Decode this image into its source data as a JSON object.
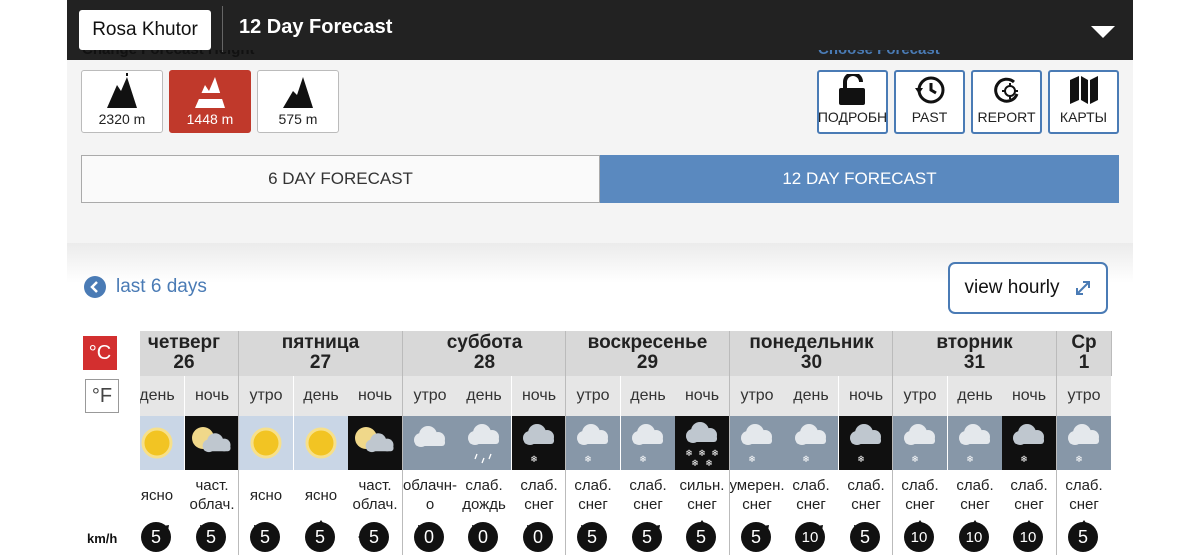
{
  "header": {
    "location": "Rosa Khutor",
    "title": "12 Day Forecast"
  },
  "height_section": {
    "label": "Change Forecast Height",
    "buttons": [
      {
        "label": "2320 m",
        "icon": "mountain-top-icon",
        "active": false
      },
      {
        "label": "1448 m",
        "icon": "mountain-mid-icon",
        "active": true
      },
      {
        "label": "575 m",
        "icon": "mountain-bottom-icon",
        "active": false
      }
    ]
  },
  "choose_section": {
    "label": "Choose Forecast",
    "buttons": [
      {
        "label": "ПОДРОБН",
        "icon": "unlock-icon"
      },
      {
        "label": "PAST",
        "icon": "history-icon"
      },
      {
        "label": "REPORT",
        "icon": "report-icon"
      },
      {
        "label": "КАРТЫ",
        "icon": "map-icon"
      }
    ]
  },
  "tabs": {
    "six_day": "6 DAY FORECAST",
    "twelve_day": "12 DAY FORECAST",
    "active": "12 DAY FORECAST"
  },
  "nav": {
    "last_days": "last 6 days",
    "view_hourly": "view hourly"
  },
  "units": {
    "celsius": "°C",
    "fahrenheit": "°F",
    "active": "°C",
    "wind_unit": "km/h"
  },
  "colors": {
    "accent_blue": "#4a7bb5",
    "tab_active": "#5a89bf",
    "height_active": "#c0392b",
    "unit_active": "#d32f2f",
    "topbar": "#222222"
  },
  "forecast": {
    "days": [
      {
        "name": "четверг",
        "date": "26"
      },
      {
        "name": "пятница",
        "date": "27"
      },
      {
        "name": "суббота",
        "date": "28"
      },
      {
        "name": "воскресенье",
        "date": "29"
      },
      {
        "name": "понедельник",
        "date": "30"
      },
      {
        "name": "вторник",
        "date": "31"
      },
      {
        "name": "Ср",
        "date": "1"
      }
    ],
    "periods": [
      {
        "period": "день",
        "icon": "sun-icon",
        "desc": "ясно",
        "wind": "5",
        "dir": 45
      },
      {
        "period": "ночь",
        "icon": "night-partly-cloudy-icon",
        "desc": "част. облач.",
        "wind": "5",
        "dir": -45
      },
      {
        "period": "утро",
        "icon": "sun-icon",
        "desc": "ясно",
        "wind": "5",
        "dir": -45
      },
      {
        "period": "день",
        "icon": "sun-icon",
        "desc": "ясно",
        "wind": "5",
        "dir": 0
      },
      {
        "period": "ночь",
        "icon": "night-partly-cloudy-icon",
        "desc": "част. облач.",
        "wind": "5",
        "dir": -90
      },
      {
        "period": "утро",
        "icon": "cloud-icon",
        "desc": "облачн- о",
        "wind": "0",
        "dir": -45
      },
      {
        "period": "день",
        "icon": "rain-icon",
        "desc": "слаб. дождь",
        "wind": "0",
        "dir": -45
      },
      {
        "period": "ночь",
        "icon": "night-snow-icon",
        "desc": "слаб. снег",
        "wind": "0",
        "dir": -45
      },
      {
        "period": "утро",
        "icon": "snow-icon",
        "desc": "слаб. снег",
        "wind": "5",
        "dir": -45
      },
      {
        "period": "день",
        "icon": "snow-icon",
        "desc": "слаб. снег",
        "wind": "5",
        "dir": 45
      },
      {
        "period": "ночь",
        "icon": "night-heavy-snow-icon",
        "desc": "сильн. снег",
        "wind": "5",
        "dir": 0
      },
      {
        "period": "утро",
        "icon": "snow-icon",
        "desc": "умерен. снег",
        "wind": "5",
        "dir": 45
      },
      {
        "period": "день",
        "icon": "snow-icon",
        "desc": "слаб. снег",
        "wind": "10",
        "dir": 45
      },
      {
        "period": "ночь",
        "icon": "night-snow-icon",
        "desc": "слаб. снег",
        "wind": "5",
        "dir": -45
      },
      {
        "period": "утро",
        "icon": "snow-icon",
        "desc": "слаб. снег",
        "wind": "10",
        "dir": 0
      },
      {
        "period": "день",
        "icon": "snow-icon",
        "desc": "слаб. снег",
        "wind": "10",
        "dir": 0
      },
      {
        "period": "ночь",
        "icon": "night-snow-icon",
        "desc": "слаб. снег",
        "wind": "10",
        "dir": 0
      },
      {
        "period": "утро",
        "icon": "snow-icon",
        "desc": "слаб. снег",
        "wind": "5",
        "dir": 0
      }
    ]
  }
}
